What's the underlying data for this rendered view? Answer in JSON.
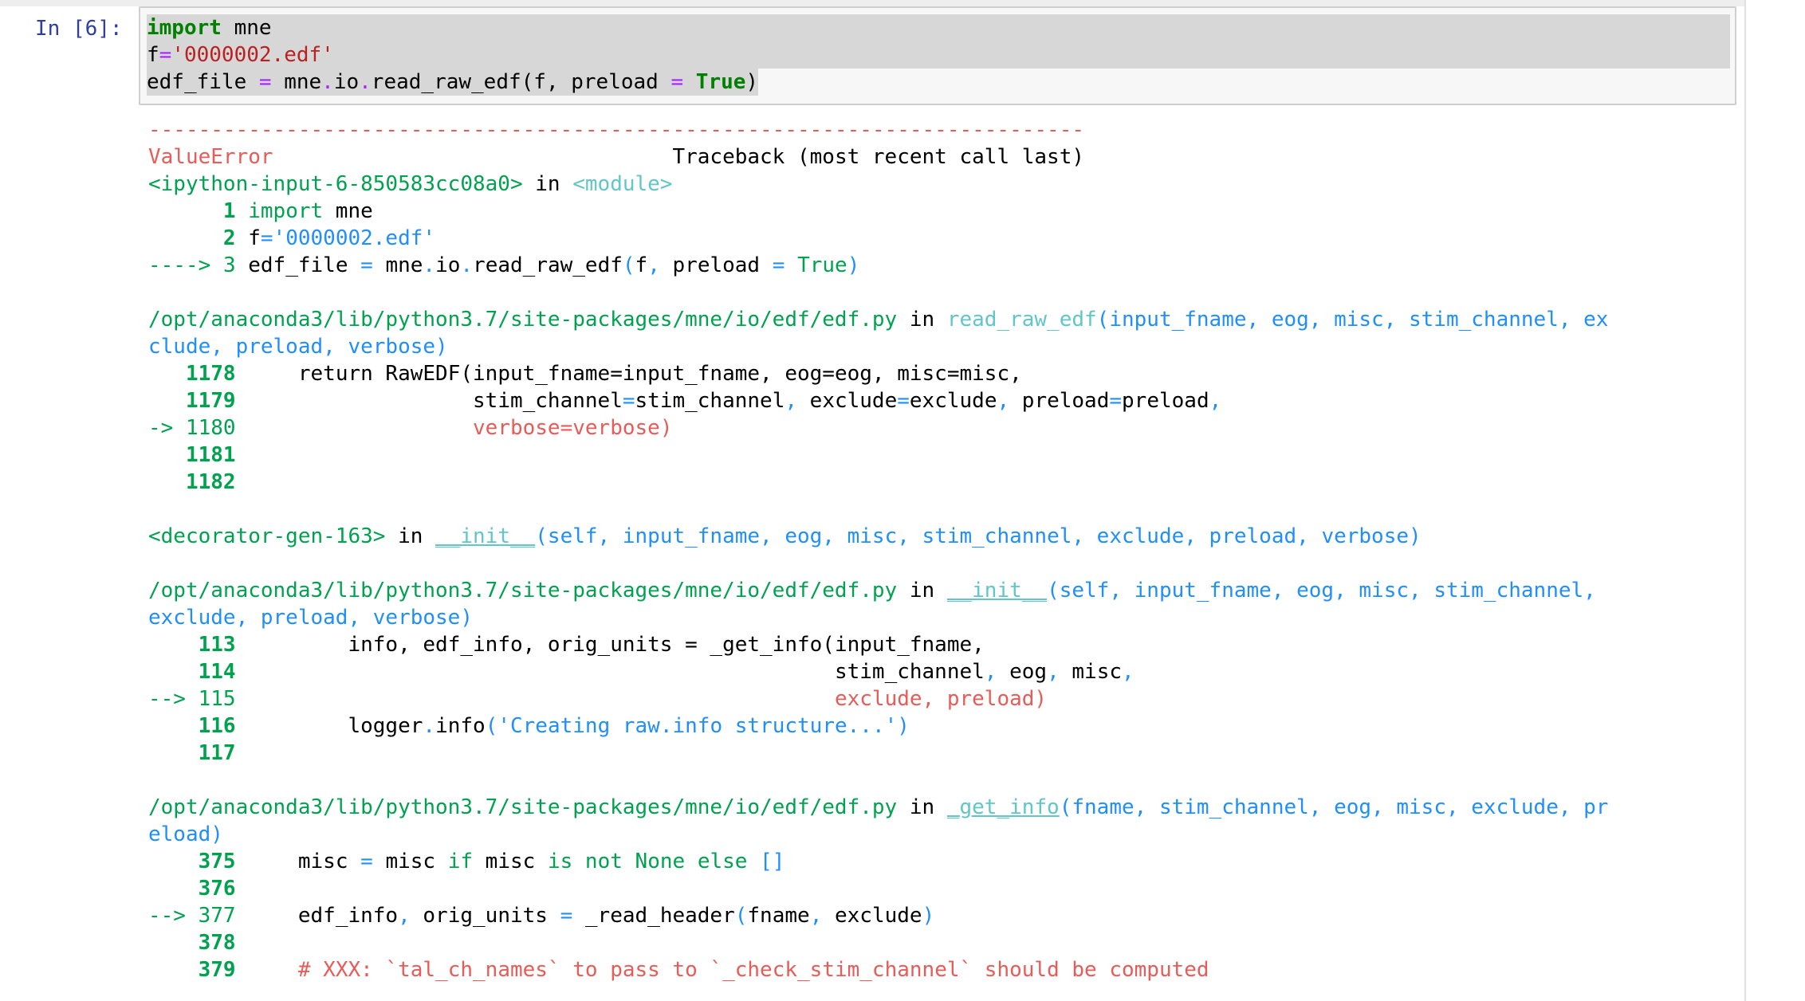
{
  "cell": {
    "prompt": "In [6]:",
    "input_lines": [
      "import mne",
      "f='0000002.edf'",
      "edf_file = mne.io.read_raw_edf(f, preload = True)"
    ]
  },
  "traceback": {
    "separator": "---------------------------------------------------------------------------",
    "error_type": "ValueError",
    "traceback_header": "Traceback (most recent call last)",
    "frames": [
      {
        "location": "<ipython-input-6-850583cc08a0>",
        "in_word": "in",
        "function": "<module>",
        "lines": [
          {
            "marker": "",
            "num": "1",
            "code": "import mne"
          },
          {
            "marker": "",
            "num": "2",
            "code": "f='0000002.edf'"
          },
          {
            "marker": "---->",
            "num": "3",
            "code": "edf_file = mne.io.read_raw_edf(f, preload = True)"
          }
        ]
      },
      {
        "location": "/opt/anaconda3/lib/python3.7/site-packages/mne/io/edf/edf.py",
        "in_word": "in",
        "function": "read_raw_edf(input_fname, eog, misc, stim_channel, exclude, preload, verbose)",
        "lines": [
          {
            "marker": "",
            "num": "1178",
            "code": "return RawEDF(input_fname=input_fname, eog=eog, misc=misc,"
          },
          {
            "marker": "",
            "num": "1179",
            "code": "stim_channel=stim_channel, exclude=exclude, preload=preload,"
          },
          {
            "marker": "->",
            "num": "1180",
            "code": "verbose=verbose)"
          },
          {
            "marker": "",
            "num": "1181",
            "code": ""
          },
          {
            "marker": "",
            "num": "1182",
            "code": ""
          }
        ]
      },
      {
        "location": "<decorator-gen-163>",
        "in_word": "in",
        "function": "__init__(self, input_fname, eog, misc, stim_channel, exclude, preload, verbose)",
        "lines": []
      },
      {
        "location": "/opt/anaconda3/lib/python3.7/site-packages/mne/io/edf/edf.py",
        "in_word": "in",
        "function": "__init__(self, input_fname, eog, misc, stim_channel, exclude, preload, verbose)",
        "lines": [
          {
            "marker": "",
            "num": "113",
            "code": "info, edf_info, orig_units = _get_info(input_fname,"
          },
          {
            "marker": "",
            "num": "114",
            "code": "stim_channel, eog, misc,"
          },
          {
            "marker": "-->",
            "num": "115",
            "code": "exclude, preload)"
          },
          {
            "marker": "",
            "num": "116",
            "code": "logger.info('Creating raw.info structure...')"
          },
          {
            "marker": "",
            "num": "117",
            "code": ""
          }
        ]
      },
      {
        "location": "/opt/anaconda3/lib/python3.7/site-packages/mne/io/edf/edf.py",
        "in_word": "in",
        "function": "_get_info(fname, stim_channel, eog, misc, exclude, preload)",
        "lines": [
          {
            "marker": "",
            "num": "375",
            "code": "misc = misc if misc is not None else []"
          },
          {
            "marker": "",
            "num": "376",
            "code": ""
          },
          {
            "marker": "-->",
            "num": "377",
            "code": "edf_info, orig_units = _read_header(fname, exclude)"
          },
          {
            "marker": "",
            "num": "378",
            "code": ""
          },
          {
            "marker": "",
            "num": "379",
            "code": "# XXX: `tal_ch_names` to pass to `_check_stim_channel` should be computed"
          }
        ]
      }
    ]
  }
}
